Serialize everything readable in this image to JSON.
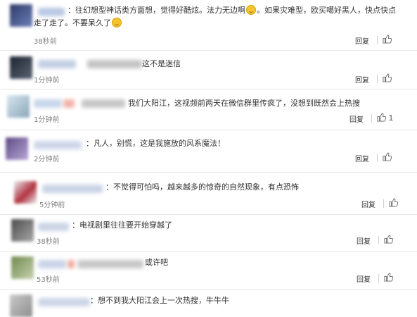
{
  "icons": {
    "like": "thumbs-up-icon",
    "emoji": "grin-emoji-icon"
  },
  "comments": [
    {
      "text_a": "：往幻想型神话类方面想，觉得好酷炫。法力无边啊",
      "text_b": "。如果灾难型，欧买噶好黑人，快点快点",
      "text_c": "走了走了。不要呆久了",
      "time": "38秒前",
      "reply": "回复",
      "likes": ""
    },
    {
      "text": "这不是迷信",
      "time": "1分钟前",
      "reply": "回复",
      "likes": ""
    },
    {
      "text": "我们大阳江，这视频前两天在微信群里传疯了，没想到既然会上热搜",
      "time": "1分钟前",
      "reply": "回复",
      "likes": "1"
    },
    {
      "text": "：凡人，别慌，这是我施放的风系魔法！",
      "time": "2分钟前",
      "reply": "回复",
      "likes": ""
    },
    {
      "text": "：不觉得可怕吗，越来越多的惊奇的自然现象，有点恐怖",
      "time": "5分钟前",
      "reply": "回复",
      "likes": ""
    },
    {
      "text": "：电视剧里往往要开始穿越了",
      "time": "38秒前",
      "reply": "回复",
      "likes": ""
    },
    {
      "text": "或许吧",
      "time": "53秒前",
      "reply": "回复",
      "likes": ""
    },
    {
      "text": "：想不到我大阳江会上一次热搜，牛牛牛",
      "time": "",
      "reply": "",
      "likes": ""
    }
  ]
}
